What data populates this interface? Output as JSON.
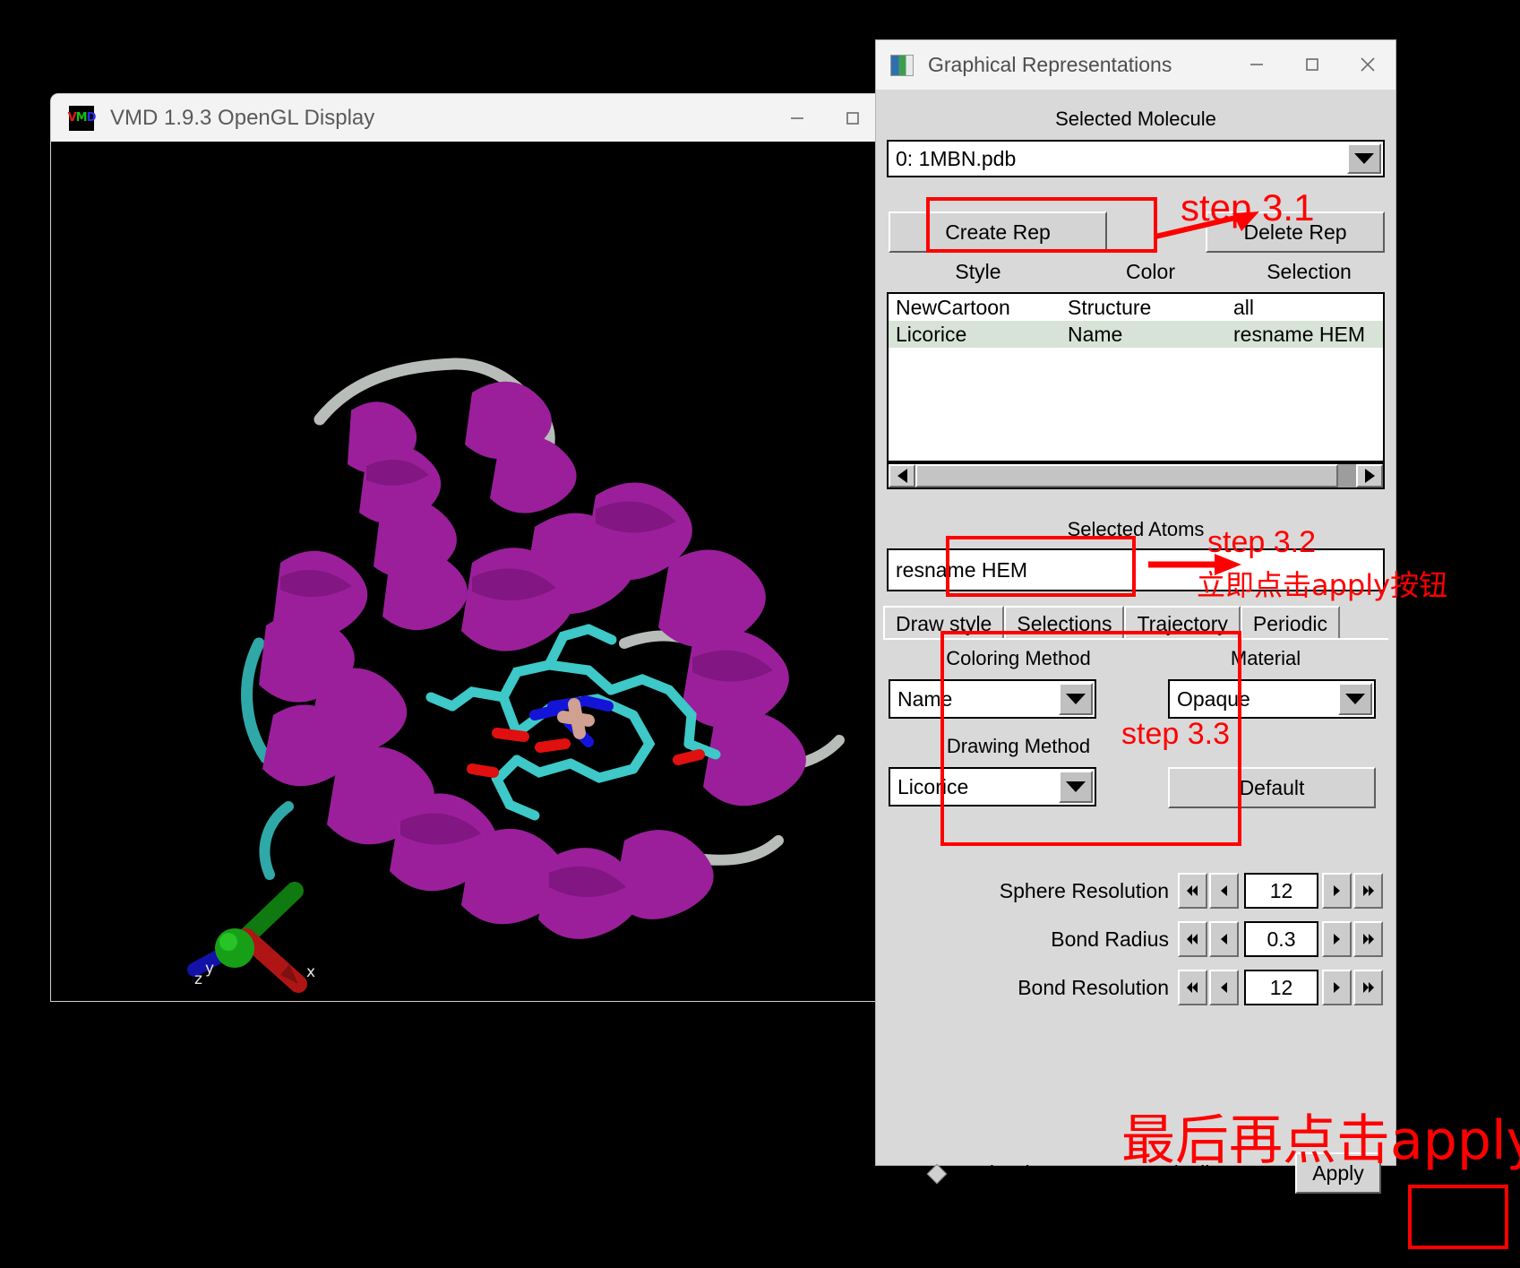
{
  "vmd_window": {
    "title": "VMD 1.9.3 OpenGL Display",
    "icon": "vmd-logo-icon",
    "icon_letters": {
      "v": "V",
      "m": "M",
      "d": "D"
    },
    "controls": {
      "minimize": "minimize-icon",
      "maximize": "maximize-icon",
      "close": "close-icon"
    },
    "viewport": {
      "molecule": "1MBN myoglobin",
      "axes": {
        "x_label": "x",
        "y_label": "y",
        "z_label": "z"
      },
      "colors": {
        "background": "#000000",
        "cartoon_helix": "#9b1f9b",
        "cartoon_coil": "#b0b6b0",
        "cartoon_turn": "#2aa5a5",
        "ligand_carbon": "#3ec8c8",
        "ligand_nitrogen": "#1414d8",
        "ligand_oxygen": "#e01010",
        "ligand_iron": "#d0a090",
        "axis_x": "#c01010",
        "axis_y": "#10a010",
        "axis_z": "#1010b0"
      }
    }
  },
  "gr_window": {
    "title": "Graphical Representations",
    "icon": "graphical-representations-icon",
    "controls": {
      "minimize": "minimize-icon",
      "maximize": "maximize-icon",
      "close": "close-icon"
    },
    "selected_molecule": {
      "label": "Selected Molecule",
      "value": "0: 1MBN.pdb"
    },
    "buttons": {
      "create_rep": "Create Rep",
      "delete_rep": "Delete Rep",
      "default": "Default",
      "apply": "Apply"
    },
    "rep_table": {
      "headers": {
        "style": "Style",
        "color": "Color",
        "selection": "Selection"
      },
      "rows": [
        {
          "style": "NewCartoon",
          "color": "Structure",
          "selection": "all",
          "selected": false
        },
        {
          "style": "Licorice",
          "color": "Name",
          "selection": "resname HEM",
          "selected": true
        }
      ]
    },
    "selected_atoms": {
      "label": "Selected Atoms",
      "value": "resname HEM"
    },
    "tabs": [
      {
        "label": "Draw style",
        "active": true
      },
      {
        "label": "Selections",
        "active": false
      },
      {
        "label": "Trajectory",
        "active": false
      },
      {
        "label": "Periodic",
        "active": false
      }
    ],
    "draw_style": {
      "coloring_method_label": "Coloring Method",
      "coloring_method_value": "Name",
      "drawing_method_label": "Drawing Method",
      "drawing_method_value": "Licorice",
      "material_label": "Material",
      "material_value": "Opaque"
    },
    "spinners": [
      {
        "label": "Sphere Resolution",
        "value": "12"
      },
      {
        "label": "Bond Radius",
        "value": "0.3"
      },
      {
        "label": "Bond Resolution",
        "value": "12"
      }
    ],
    "apply_auto": {
      "label": "Apply Changes Automatically",
      "checked": false
    }
  },
  "annotations": {
    "color": "#ff0000",
    "step_3_1": "step 3.1",
    "step_3_2": "step 3.2",
    "step_3_2_cn": "立即点击apply按钮",
    "step_3_3": "step 3.3",
    "final_cn": "最后再点击apply"
  }
}
